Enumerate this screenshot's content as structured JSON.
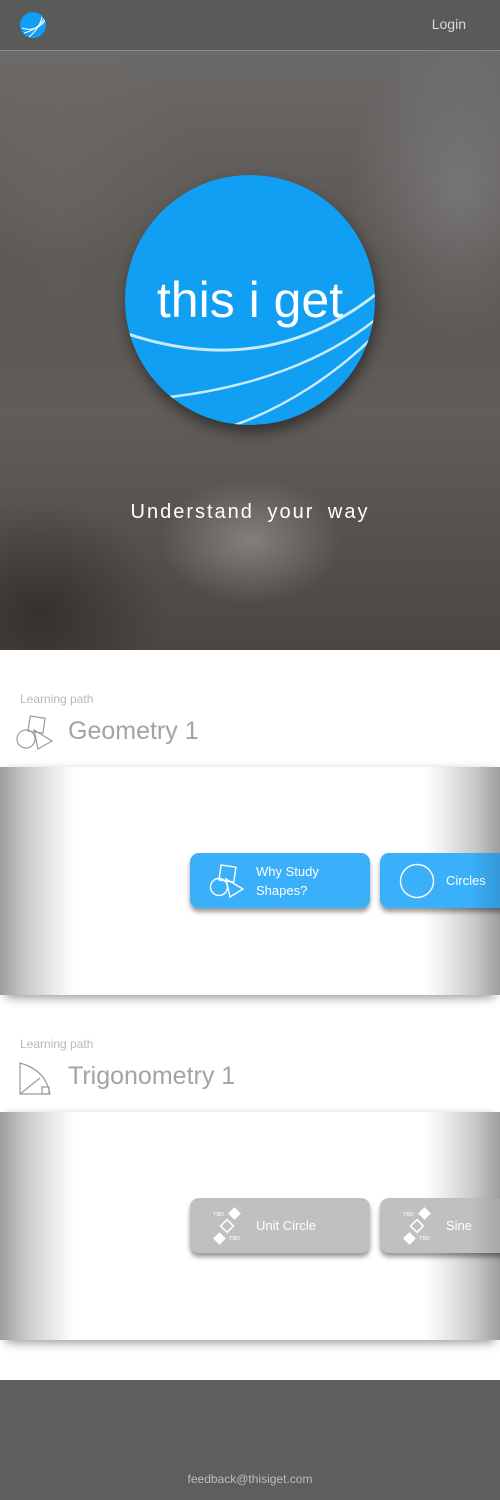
{
  "nav": {
    "login_label": "Login",
    "logo_icon": "brand-globe-icon"
  },
  "hero": {
    "title": "this i get",
    "tagline": "Understand your way",
    "accent_color": "#109ff3"
  },
  "paths": [
    {
      "label": "Learning path",
      "title": "Geometry 1",
      "icon": "shapes-icon",
      "cards": [
        {
          "label": "Why Study Shapes?",
          "icon": "shapes-icon",
          "color": "#3bb0fa"
        },
        {
          "label": "Circles",
          "icon": "circle-icon",
          "color": "#3bb0fa"
        }
      ]
    },
    {
      "label": "Learning path",
      "title": "Trigonometry 1",
      "icon": "right-triangle-icon",
      "cards": [
        {
          "label": "Unit Circle",
          "icon": "tbd-icon",
          "icon_text": "TBD",
          "color": "#c0c0c0"
        },
        {
          "label": "Sine",
          "icon": "tbd-icon",
          "icon_text": "TBD",
          "color": "#c0c0c0"
        }
      ]
    }
  ],
  "footer": {
    "email": "feedback@thisiget.com"
  }
}
